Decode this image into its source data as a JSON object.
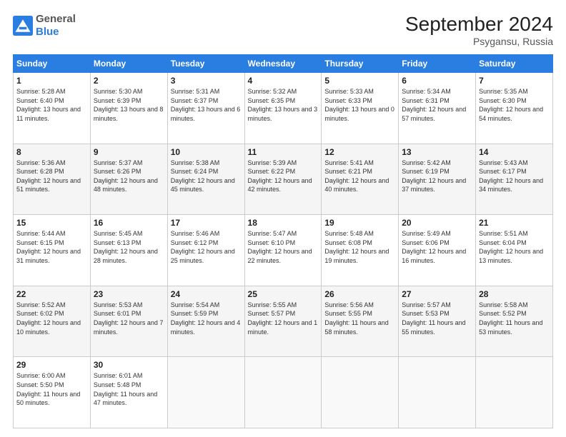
{
  "logo": {
    "general": "General",
    "blue": "Blue"
  },
  "header": {
    "month": "September 2024",
    "location": "Psygansu, Russia"
  },
  "weekdays": [
    "Sunday",
    "Monday",
    "Tuesday",
    "Wednesday",
    "Thursday",
    "Friday",
    "Saturday"
  ],
  "weeks": [
    [
      {
        "day": "1",
        "sunrise": "Sunrise: 5:28 AM",
        "sunset": "Sunset: 6:40 PM",
        "daylight": "Daylight: 13 hours and 11 minutes."
      },
      {
        "day": "2",
        "sunrise": "Sunrise: 5:30 AM",
        "sunset": "Sunset: 6:39 PM",
        "daylight": "Daylight: 13 hours and 8 minutes."
      },
      {
        "day": "3",
        "sunrise": "Sunrise: 5:31 AM",
        "sunset": "Sunset: 6:37 PM",
        "daylight": "Daylight: 13 hours and 6 minutes."
      },
      {
        "day": "4",
        "sunrise": "Sunrise: 5:32 AM",
        "sunset": "Sunset: 6:35 PM",
        "daylight": "Daylight: 13 hours and 3 minutes."
      },
      {
        "day": "5",
        "sunrise": "Sunrise: 5:33 AM",
        "sunset": "Sunset: 6:33 PM",
        "daylight": "Daylight: 13 hours and 0 minutes."
      },
      {
        "day": "6",
        "sunrise": "Sunrise: 5:34 AM",
        "sunset": "Sunset: 6:31 PM",
        "daylight": "Daylight: 12 hours and 57 minutes."
      },
      {
        "day": "7",
        "sunrise": "Sunrise: 5:35 AM",
        "sunset": "Sunset: 6:30 PM",
        "daylight": "Daylight: 12 hours and 54 minutes."
      }
    ],
    [
      {
        "day": "8",
        "sunrise": "Sunrise: 5:36 AM",
        "sunset": "Sunset: 6:28 PM",
        "daylight": "Daylight: 12 hours and 51 minutes."
      },
      {
        "day": "9",
        "sunrise": "Sunrise: 5:37 AM",
        "sunset": "Sunset: 6:26 PM",
        "daylight": "Daylight: 12 hours and 48 minutes."
      },
      {
        "day": "10",
        "sunrise": "Sunrise: 5:38 AM",
        "sunset": "Sunset: 6:24 PM",
        "daylight": "Daylight: 12 hours and 45 minutes."
      },
      {
        "day": "11",
        "sunrise": "Sunrise: 5:39 AM",
        "sunset": "Sunset: 6:22 PM",
        "daylight": "Daylight: 12 hours and 42 minutes."
      },
      {
        "day": "12",
        "sunrise": "Sunrise: 5:41 AM",
        "sunset": "Sunset: 6:21 PM",
        "daylight": "Daylight: 12 hours and 40 minutes."
      },
      {
        "day": "13",
        "sunrise": "Sunrise: 5:42 AM",
        "sunset": "Sunset: 6:19 PM",
        "daylight": "Daylight: 12 hours and 37 minutes."
      },
      {
        "day": "14",
        "sunrise": "Sunrise: 5:43 AM",
        "sunset": "Sunset: 6:17 PM",
        "daylight": "Daylight: 12 hours and 34 minutes."
      }
    ],
    [
      {
        "day": "15",
        "sunrise": "Sunrise: 5:44 AM",
        "sunset": "Sunset: 6:15 PM",
        "daylight": "Daylight: 12 hours and 31 minutes."
      },
      {
        "day": "16",
        "sunrise": "Sunrise: 5:45 AM",
        "sunset": "Sunset: 6:13 PM",
        "daylight": "Daylight: 12 hours and 28 minutes."
      },
      {
        "day": "17",
        "sunrise": "Sunrise: 5:46 AM",
        "sunset": "Sunset: 6:12 PM",
        "daylight": "Daylight: 12 hours and 25 minutes."
      },
      {
        "day": "18",
        "sunrise": "Sunrise: 5:47 AM",
        "sunset": "Sunset: 6:10 PM",
        "daylight": "Daylight: 12 hours and 22 minutes."
      },
      {
        "day": "19",
        "sunrise": "Sunrise: 5:48 AM",
        "sunset": "Sunset: 6:08 PM",
        "daylight": "Daylight: 12 hours and 19 minutes."
      },
      {
        "day": "20",
        "sunrise": "Sunrise: 5:49 AM",
        "sunset": "Sunset: 6:06 PM",
        "daylight": "Daylight: 12 hours and 16 minutes."
      },
      {
        "day": "21",
        "sunrise": "Sunrise: 5:51 AM",
        "sunset": "Sunset: 6:04 PM",
        "daylight": "Daylight: 12 hours and 13 minutes."
      }
    ],
    [
      {
        "day": "22",
        "sunrise": "Sunrise: 5:52 AM",
        "sunset": "Sunset: 6:02 PM",
        "daylight": "Daylight: 12 hours and 10 minutes."
      },
      {
        "day": "23",
        "sunrise": "Sunrise: 5:53 AM",
        "sunset": "Sunset: 6:01 PM",
        "daylight": "Daylight: 12 hours and 7 minutes."
      },
      {
        "day": "24",
        "sunrise": "Sunrise: 5:54 AM",
        "sunset": "Sunset: 5:59 PM",
        "daylight": "Daylight: 12 hours and 4 minutes."
      },
      {
        "day": "25",
        "sunrise": "Sunrise: 5:55 AM",
        "sunset": "Sunset: 5:57 PM",
        "daylight": "Daylight: 12 hours and 1 minute."
      },
      {
        "day": "26",
        "sunrise": "Sunrise: 5:56 AM",
        "sunset": "Sunset: 5:55 PM",
        "daylight": "Daylight: 11 hours and 58 minutes."
      },
      {
        "day": "27",
        "sunrise": "Sunrise: 5:57 AM",
        "sunset": "Sunset: 5:53 PM",
        "daylight": "Daylight: 11 hours and 55 minutes."
      },
      {
        "day": "28",
        "sunrise": "Sunrise: 5:58 AM",
        "sunset": "Sunset: 5:52 PM",
        "daylight": "Daylight: 11 hours and 53 minutes."
      }
    ],
    [
      {
        "day": "29",
        "sunrise": "Sunrise: 6:00 AM",
        "sunset": "Sunset: 5:50 PM",
        "daylight": "Daylight: 11 hours and 50 minutes."
      },
      {
        "day": "30",
        "sunrise": "Sunrise: 6:01 AM",
        "sunset": "Sunset: 5:48 PM",
        "daylight": "Daylight: 11 hours and 47 minutes."
      },
      null,
      null,
      null,
      null,
      null
    ]
  ]
}
